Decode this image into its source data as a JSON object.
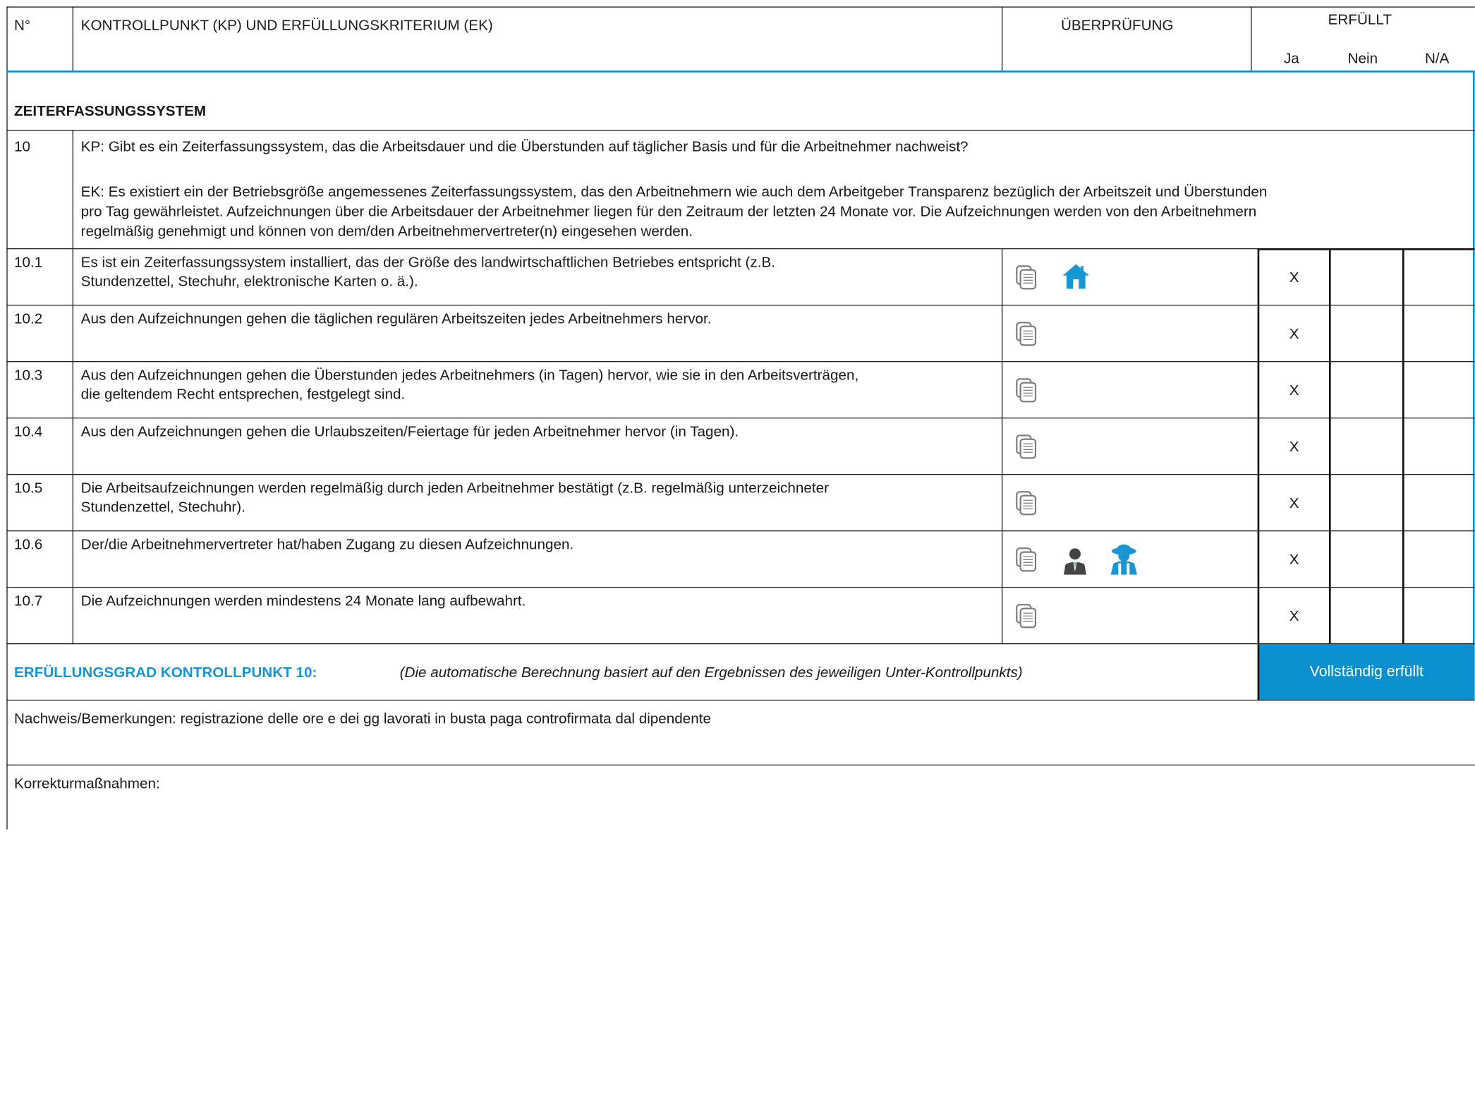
{
  "header": {
    "num": "N°",
    "title": "KONTROLLPUNKT (KP) UND ERFÜLLUNGSKRITERIUM (EK)",
    "check": "ÜBERPRÜFUNG",
    "fulfilled": "ERFÜLLT",
    "yes": "Ja",
    "no": "Nein",
    "na": "N/A"
  },
  "section": {
    "title": "ZEITERFASSUNGSSYSTEM"
  },
  "main_point": {
    "num": "10",
    "kp": "KP: Gibt es ein Zeiterfassungssystem, das die Arbeitsdauer und die Überstunden auf täglicher Basis und für die Arbeitnehmer nachweist?",
    "ek_lines": [
      "EK: Es existiert ein der Betriebsgröße angemessenes Zeiterfassungssystem, das den Arbeitnehmern wie auch dem Arbeitgeber Transparenz bezüglich der Arbeitszeit und Überstunden",
      "pro Tag gewährleistet. Aufzeichnungen über die Arbeitsdauer der Arbeitnehmer liegen für den Zeitraum der letzten 24 Monate vor. Die Aufzeichnungen werden von den Arbeitnehmern",
      "regelmäßig genehmigt und können von dem/den Arbeitnehmervertreter(n) eingesehen werden."
    ]
  },
  "rows": [
    {
      "num": "10.1",
      "lines": [
        "Es ist ein Zeiterfassungssystem installiert, das der Größe des landwirtschaftlichen Betriebes entspricht (z.B.",
        "Stundenzettel, Stechuhr, elektronische Karten o. ä.)."
      ],
      "icons": [
        "document-icon",
        "farm-house-icon"
      ],
      "mark": "X"
    },
    {
      "num": "10.2",
      "lines": [
        "Aus den Aufzeichnungen gehen die täglichen regulären Arbeitszeiten jedes Arbeitnehmers hervor."
      ],
      "icons": [
        "document-icon"
      ],
      "mark": "X"
    },
    {
      "num": "10.3",
      "lines": [
        "Aus den Aufzeichnungen gehen die Überstunden jedes Arbeitnehmers (in Tagen) hervor, wie sie in den Arbeitsverträgen,",
        "die geltendem Recht entsprechen, festgelegt sind."
      ],
      "icons": [
        "document-icon"
      ],
      "mark": "X"
    },
    {
      "num": "10.4",
      "lines": [
        "Aus den Aufzeichnungen gehen die Urlaubszeiten/Feiertage für jeden Arbeitnehmer hervor (in Tagen)."
      ],
      "icons": [
        "document-icon"
      ],
      "mark": "X"
    },
    {
      "num": "10.5",
      "lines": [
        "Die Arbeitsaufzeichnungen werden regelmäßig durch jeden Arbeitnehmer bestätigt (z.B. regelmäßig unterzeichneter",
        "Stundenzettel, Stechuhr)."
      ],
      "icons": [
        "document-icon"
      ],
      "mark": "X"
    },
    {
      "num": "10.6",
      "lines": [
        "Der/die Arbeitnehmervertreter hat/haben Zugang zu diesen Aufzeichnungen."
      ],
      "icons": [
        "document-icon",
        "manager-icon",
        "worker-icon"
      ],
      "mark": "X"
    },
    {
      "num": "10.7",
      "lines": [
        "Die Aufzeichnungen werden mindestens 24 Monate lang aufbewahrt."
      ],
      "icons": [
        "document-icon"
      ],
      "mark": "X"
    }
  ],
  "summary": {
    "label": "ERFÜLLUNGSGRAD KONTROLLPUNKT 10:",
    "note": "(Die automatische Berechnung basiert auf den Ergebnissen des jeweiligen Unter-Kontrollpunkts)",
    "status": "Vollständig erfüllt"
  },
  "remarks": {
    "evidence": "Nachweis/Bemerkungen: registrazione delle ore e dei gg lavorati in busta paga controfirmata dal dipendente",
    "corrective": "Korrekturmaßnahmen:"
  },
  "colors": {
    "accent": "#0a8fd1",
    "icon_gray": "#7a7a7a",
    "icon_dark": "#444444"
  }
}
